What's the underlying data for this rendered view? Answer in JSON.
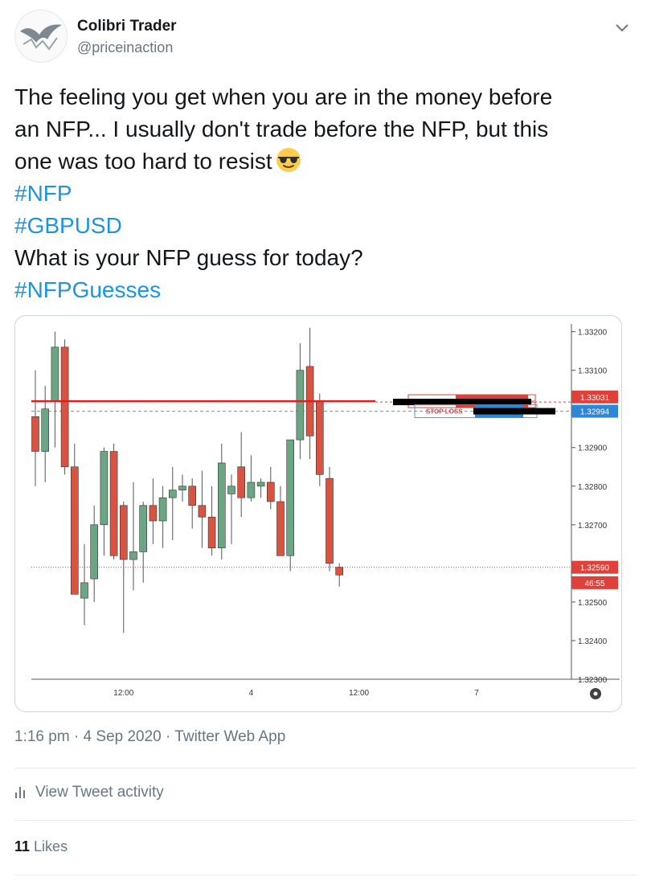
{
  "author": {
    "name": "Colibri Trader",
    "handle": "@priceinaction"
  },
  "icons": {
    "menu": "chevron-down-icon",
    "emoji": "smiling-face-with-sunglasses-icon",
    "activity": "bar-chart-icon",
    "settings": "gear-icon"
  },
  "tweet": {
    "line1": "The feeling you get when you are in the money before",
    "line2": "an NFP... I usually don't trade before the NFP, but this",
    "line3": "one was too hard to resist",
    "hashtag1": "#NFP",
    "hashtag2": "#GBPUSD",
    "line4": "What is your NFP guess for today?",
    "hashtag3": "#NFPGuesses"
  },
  "meta": {
    "time": "1:16 pm",
    "separator": " · ",
    "date": "4 Sep 2020",
    "source": "Twitter Web App"
  },
  "actions": {
    "view_activity": "View Tweet activity",
    "likes_count": "11",
    "likes_label": "Likes"
  },
  "colors": {
    "hashtag": "#1b95e0",
    "muted": "#657786",
    "bull": "#6ba583",
    "bear": "#d75442",
    "line_red": "#e01e1e",
    "line_blue": "#2f86d6"
  },
  "chart_data": {
    "type": "candlestick",
    "instrument": "GBPUSD",
    "ylim": [
      1.323,
      1.3322
    ],
    "y_ticks": [
      "1.33200",
      "1.33100",
      "1.32900",
      "1.32800",
      "1.32700",
      "1.32500",
      "1.32400",
      "1.32300"
    ],
    "x_tick_labels": [
      "12:00",
      "4",
      "12:00",
      "7"
    ],
    "x_tick_index": [
      9,
      22,
      33,
      45
    ],
    "price_labels": [
      {
        "text": "1.33031",
        "price": 1.33031,
        "color": "#e0403a"
      },
      {
        "text": "1.32994",
        "price": 1.32994,
        "color": "#2f86d6"
      },
      {
        "text": "1.32590",
        "price": 1.3259,
        "color": "#e0403a"
      },
      {
        "text": "46:55",
        "price": 1.3255,
        "color": "#e0403a"
      }
    ],
    "entry_line": 1.3302,
    "stop_loss_line": 1.32994,
    "current_price_line": 1.3259,
    "annotation": "STOP LOSS",
    "candles": [
      {
        "o": 1.3298,
        "h": 1.331,
        "l": 1.328,
        "c": 1.3289
      },
      {
        "o": 1.3289,
        "h": 1.3306,
        "l": 1.3281,
        "c": 1.33
      },
      {
        "o": 1.3302,
        "h": 1.332,
        "l": 1.329,
        "c": 1.3316
      },
      {
        "o": 1.3316,
        "h": 1.3318,
        "l": 1.3283,
        "c": 1.3285
      },
      {
        "o": 1.3285,
        "h": 1.3291,
        "l": 1.3252,
        "c": 1.3252
      },
      {
        "o": 1.3251,
        "h": 1.3265,
        "l": 1.3244,
        "c": 1.3255
      },
      {
        "o": 1.3256,
        "h": 1.3275,
        "l": 1.325,
        "c": 1.327
      },
      {
        "o": 1.327,
        "h": 1.329,
        "l": 1.3262,
        "c": 1.3289
      },
      {
        "o": 1.3289,
        "h": 1.3291,
        "l": 1.3261,
        "c": 1.3262
      },
      {
        "o": 1.3275,
        "h": 1.3276,
        "l": 1.3242,
        "c": 1.3261
      },
      {
        "o": 1.3261,
        "h": 1.3281,
        "l": 1.3253,
        "c": 1.3263
      },
      {
        "o": 1.3263,
        "h": 1.3276,
        "l": 1.3255,
        "c": 1.3275
      },
      {
        "o": 1.3275,
        "h": 1.3282,
        "l": 1.3265,
        "c": 1.3271
      },
      {
        "o": 1.3271,
        "h": 1.328,
        "l": 1.3264,
        "c": 1.3277
      },
      {
        "o": 1.3277,
        "h": 1.3285,
        "l": 1.3266,
        "c": 1.3279
      },
      {
        "o": 1.3279,
        "h": 1.3283,
        "l": 1.3276,
        "c": 1.328
      },
      {
        "o": 1.328,
        "h": 1.3282,
        "l": 1.3269,
        "c": 1.3275
      },
      {
        "o": 1.3275,
        "h": 1.3284,
        "l": 1.3264,
        "c": 1.3272
      },
      {
        "o": 1.3272,
        "h": 1.328,
        "l": 1.3262,
        "c": 1.3264
      },
      {
        "o": 1.3264,
        "h": 1.3291,
        "l": 1.3261,
        "c": 1.3286
      },
      {
        "o": 1.3278,
        "h": 1.3283,
        "l": 1.3265,
        "c": 1.328
      },
      {
        "o": 1.3285,
        "h": 1.3294,
        "l": 1.3272,
        "c": 1.3277
      },
      {
        "o": 1.3277,
        "h": 1.3288,
        "l": 1.3276,
        "c": 1.3281
      },
      {
        "o": 1.328,
        "h": 1.3282,
        "l": 1.3277,
        "c": 1.3281
      },
      {
        "o": 1.3281,
        "h": 1.3285,
        "l": 1.3274,
        "c": 1.3276
      },
      {
        "o": 1.3276,
        "h": 1.328,
        "l": 1.3263,
        "c": 1.3262
      },
      {
        "o": 1.3262,
        "h": 1.3291,
        "l": 1.3258,
        "c": 1.3292
      },
      {
        "o": 1.3292,
        "h": 1.3317,
        "l": 1.3287,
        "c": 1.331
      },
      {
        "o": 1.3311,
        "h": 1.3321,
        "l": 1.3287,
        "c": 1.3293
      },
      {
        "o": 1.3302,
        "h": 1.3304,
        "l": 1.328,
        "c": 1.3283
      },
      {
        "o": 1.3282,
        "h": 1.3285,
        "l": 1.3258,
        "c": 1.326
      },
      {
        "o": 1.3259,
        "h": 1.326,
        "l": 1.3254,
        "c": 1.3257
      }
    ]
  }
}
